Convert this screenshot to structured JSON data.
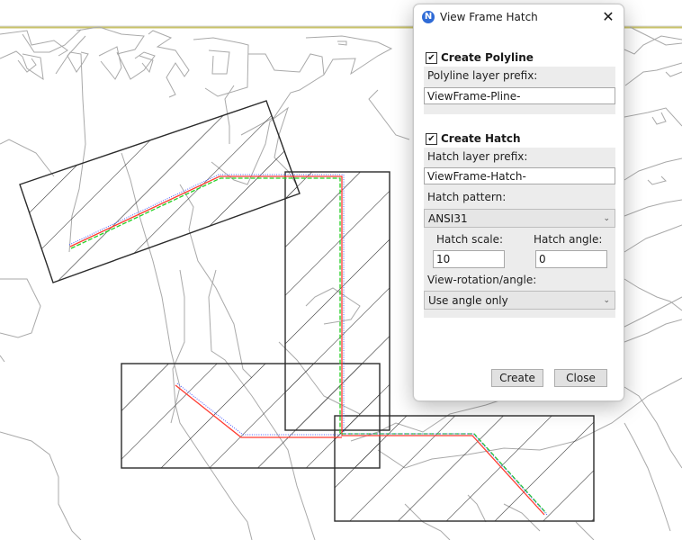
{
  "dialog": {
    "title": "View Frame Hatch",
    "app_icon_glyph": "N",
    "close_glyph": "✕",
    "polyline": {
      "checkbox_label": "Create Polyline",
      "checked": true,
      "check_glyph": "✔",
      "prefix_label": "Polyline layer prefix:",
      "prefix_value": "ViewFrame-Pline-"
    },
    "hatch": {
      "checkbox_label": "Create Hatch",
      "checked": true,
      "check_glyph": "✔",
      "prefix_label": "Hatch layer prefix:",
      "prefix_value": "ViewFrame-Hatch-",
      "pattern_label": "Hatch pattern:",
      "pattern_value": "ANSI31",
      "scale_label": "Hatch scale:",
      "scale_value": "10",
      "angle_label": "Hatch angle:",
      "angle_value": "0",
      "rotation_label": "View-rotation/angle:",
      "rotation_value": "Use angle only"
    },
    "chevron_glyph": "⌵",
    "buttons": {
      "create": "Create",
      "close": "Close"
    }
  },
  "drawing": {
    "colors": {
      "contour": "#a9a9a9",
      "frame": "#2b2b2b",
      "alignment_red": "#ff3b30",
      "alignment_green": "#22d022",
      "alignment_blue": "#4a5cff",
      "top_band": "#c8c26a"
    },
    "view_frames": [
      "frame-1-rotated",
      "frame-2-vertical",
      "frame-3-lower-left",
      "frame-4-lower-right"
    ]
  }
}
